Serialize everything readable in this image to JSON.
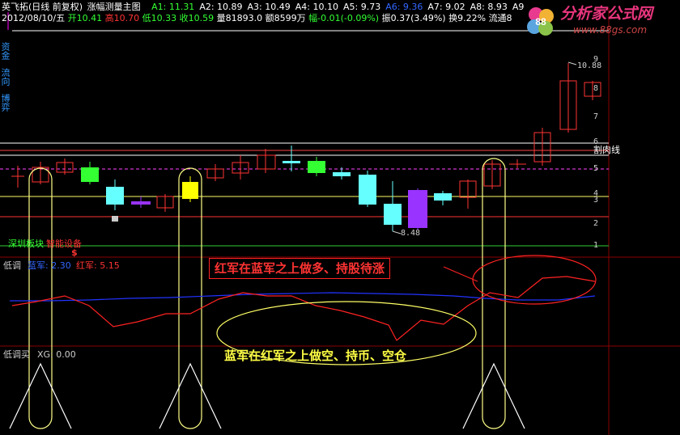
{
  "header": {
    "stock_name": "英飞拓(日线 前复权)",
    "indicator_name": "涨幅测量主图",
    "a_values": [
      {
        "label": "A1: 11.31",
        "color": "#33ff33"
      },
      {
        "label": "A2: 10.89",
        "color": "#ffffff"
      },
      {
        "label": "A3: 10.49",
        "color": "#ffffff"
      },
      {
        "label": "A4: 10.10",
        "color": "#ffffff"
      },
      {
        "label": "A5: 9.73",
        "color": "#ffffff"
      },
      {
        "label": "A6: 9.36",
        "color": "#3366ff"
      },
      {
        "label": "A7: 9.02",
        "color": "#ffffff"
      },
      {
        "label": "A8: 8.93",
        "color": "#ffffff"
      },
      {
        "label": "A9",
        "color": "#ffffff"
      }
    ],
    "date": "2012/08/10/五",
    "open": "开10.41",
    "high": "高10.70",
    "low": "低10.33",
    "close": "收10.59",
    "volume": "量81893.0",
    "amount": "额8599万",
    "change": "幅-0.01(-0.09%)",
    "amplitude": "振0.37(3.49%)",
    "turnover": "换9.22%",
    "float": "流通8",
    "colors": {
      "green": "#33ff33",
      "red": "#ff3333",
      "white": "#ffffff",
      "yellow": "#ffff00"
    }
  },
  "watermark": {
    "title": "分析家公式网",
    "url": "www.88gs.com",
    "colors": [
      "#e83a8e",
      "#f2b233",
      "#5aa5e0",
      "#8bc34a"
    ]
  },
  "price_axis": {
    "labels": [
      "9",
      "8",
      "7",
      "6",
      "5",
      "4",
      "3",
      "2",
      "1"
    ],
    "high_marker": "10.88",
    "low_marker": "8.48"
  },
  "overlays": {
    "meat_line": "割肉线",
    "sector": "深圳板块",
    "sector_sub": "智能设备",
    "dollar": "$",
    "red_note": "红军在蓝军之上做多、持股待涨",
    "blue_note": "蓝军在红军之上做空、持币、空仓"
  },
  "pane2": {
    "title": "低调",
    "blue_label": "蓝军: 2.30",
    "red_label": "红军: 5.15"
  },
  "pane3": {
    "title": "低调买",
    "xg_label": "XG: 0.00"
  },
  "left_tabs": [
    "资金",
    "流向",
    "博弈"
  ]
}
